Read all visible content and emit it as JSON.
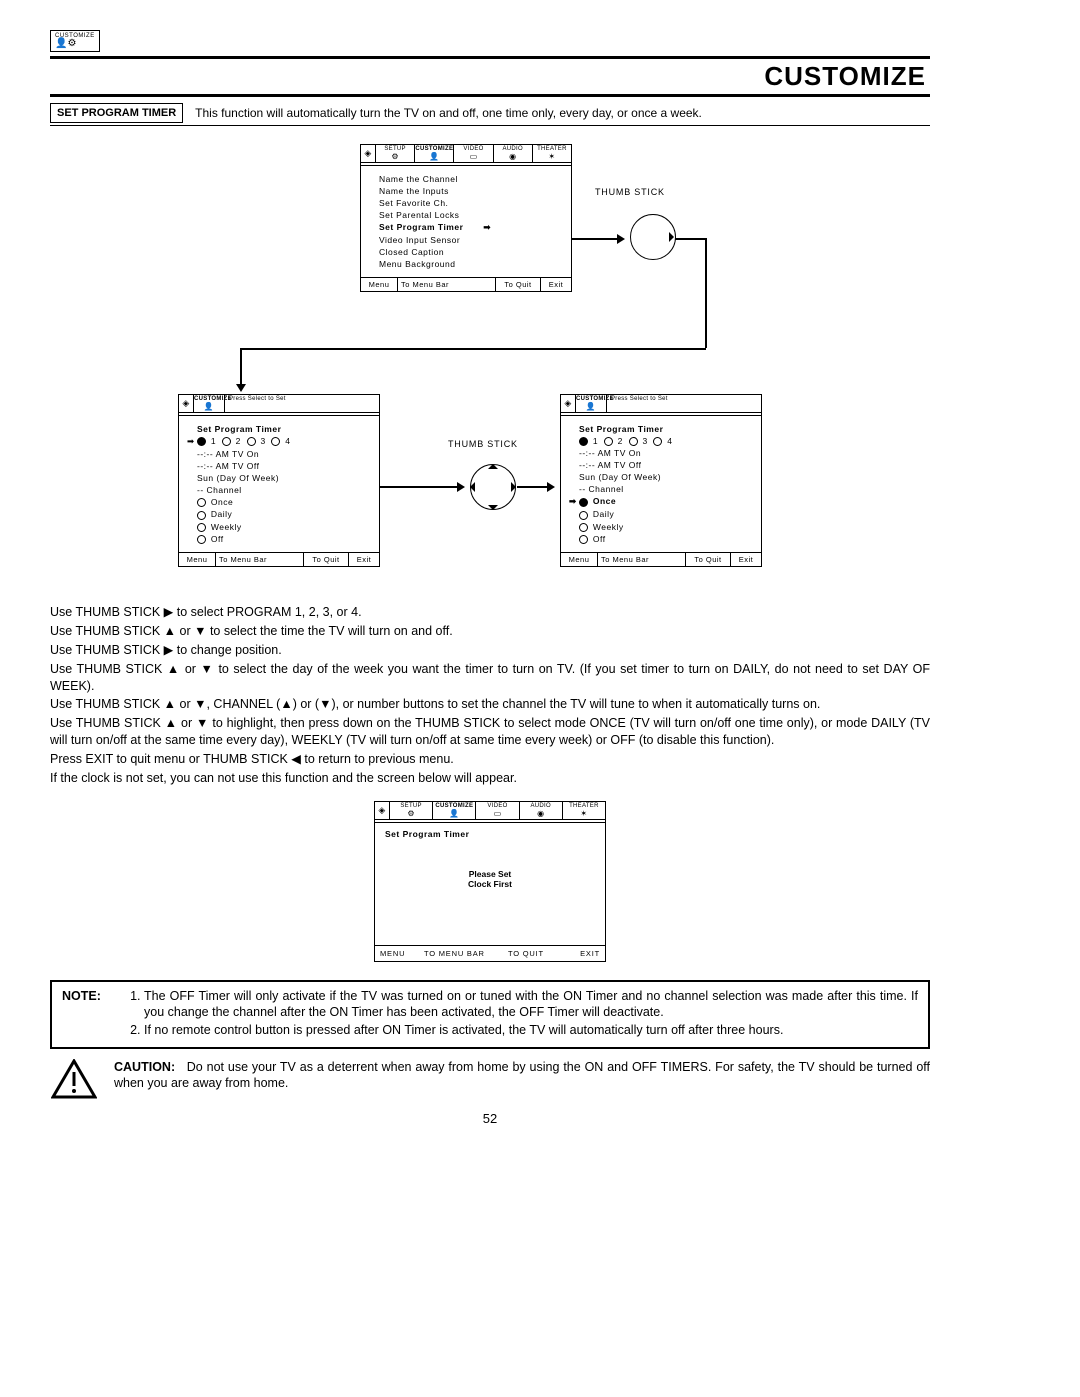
{
  "header": {
    "corner_label": "CUSTOMIZE",
    "corner_glyphs": "👤⚙",
    "title": "CUSTOMIZE"
  },
  "intro": {
    "label": "SET PROGRAM TIMER",
    "text": "This function will automatically turn the TV on and off, one time only, every day, or once a week."
  },
  "tabs": [
    "SETUP",
    "CUSTOMIZE",
    "VIDEO",
    "AUDIO",
    "THEATER"
  ],
  "tabs_small_header": "Press Select to Set",
  "thumb_label": "THUMB STICK",
  "screen1": {
    "items": [
      {
        "t": "Name the Channel"
      },
      {
        "t": "Name the Inputs"
      },
      {
        "t": "Set Favorite Ch."
      },
      {
        "t": "Set Parental Locks"
      },
      {
        "t": "Set Program Timer",
        "bold": true,
        "arrow": true
      },
      {
        "t": "Video Input Sensor"
      },
      {
        "t": "Closed Caption"
      },
      {
        "t": "Menu Background"
      }
    ],
    "footer": {
      "f1": "Menu",
      "f2": "To Menu Bar",
      "f3": "To Quit",
      "f4": "Exit"
    }
  },
  "screen2": {
    "title": "Set Program Timer",
    "radio_row": "1  2  3  4",
    "radio_sel": 0,
    "lines": [
      "--:--  AM TV On",
      "--:--  AM TV Off",
      "Sun (Day Of Week)",
      "--  Channel"
    ],
    "options": [
      "Once",
      "Daily",
      "Weekly",
      "Off"
    ],
    "option_sel": -1,
    "pointer_on_radio": true
  },
  "screen3": {
    "title": "Set Program Timer",
    "radio_row": "1  2  3  4",
    "radio_sel": 0,
    "lines": [
      "--:--  AM TV On",
      "--:--  AM TV Off",
      "Sun (Day Of Week)",
      "--  Channel"
    ],
    "options": [
      "Once",
      "Daily",
      "Weekly",
      "Off"
    ],
    "option_sel": 0,
    "pointer_on_option": true
  },
  "instructions": {
    "p1": "Use THUMB STICK ▶ to select PROGRAM 1, 2, 3, or 4.",
    "p2": "Use THUMB STICK ▲ or ▼ to select the time the TV will turn on and off.",
    "p3": "Use THUMB STICK ▶ to change position.",
    "p4": "Use THUMB STICK ▲ or ▼ to select the day of the week you want the timer to turn on TV. (If you set timer to turn on DAILY, do not need to set DAY OF WEEK).",
    "p5": "Use THUMB STICK ▲ or ▼, CHANNEL (▲) or (▼), or number buttons to set the channel the TV will tune to when it automatically turns on.",
    "p6": "Use THUMB STICK ▲ or ▼ to highlight, then press down on the THUMB STICK to select mode ONCE (TV will turn on/off one time only), or mode DAILY (TV will turn on/off at the same time every day), WEEKLY (TV will turn on/off at same time every week) or OFF (to disable this function).",
    "p7": "Press EXIT to quit menu or THUMB STICK ◀ to return to previous menu.",
    "p8": "If the clock is not set, you can not use this function and the screen below will appear."
  },
  "clock_screen": {
    "title": "Set Program Timer",
    "msg1": "Please Set",
    "msg2": "Clock First",
    "footer": {
      "f1": "MENU",
      "f2": "TO MENU BAR",
      "f3": "TO QUIT",
      "f4": "EXIT"
    }
  },
  "note": {
    "label": "NOTE:",
    "n1": "The OFF Timer will only activate if the TV was turned on or tuned with the ON Timer and no channel selection was made after this time.  If you change the channel after the ON Timer has been activated, the OFF Timer will deactivate.",
    "n2": "If no remote control button is pressed after ON Timer is activated, the TV will automatically turn off after three hours."
  },
  "caution": {
    "label": "CAUTION:",
    "text": "Do not use your TV as a deterrent when away from home by using the ON and OFF TIMERS.  For safety, the TV should be turned off when you are away from home."
  },
  "page_num": "52"
}
